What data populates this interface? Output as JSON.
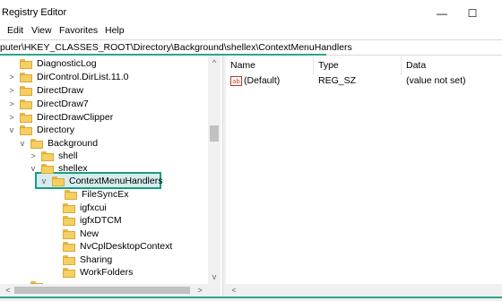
{
  "window": {
    "title": "Registry Editor",
    "minimize_glyph": "—",
    "maximize_glyph": "☐"
  },
  "menu": [
    "Edit",
    "View",
    "Favorites",
    "Help"
  ],
  "address": {
    "path": "puter\\HKEY_CLASSES_ROOT\\Directory\\Background\\shellex\\ContextMenuHandlers"
  },
  "tree": {
    "nodes": [
      {
        "label": "DiagnosticLog",
        "expander": ">"
      },
      {
        "label": "DirControl.DirList.11.0",
        "expander": ">"
      },
      {
        "label": "DirectDraw",
        "expander": ">"
      },
      {
        "label": "DirectDraw7",
        "expander": ">"
      },
      {
        "label": "DirectDrawClipper",
        "expander": ">"
      },
      {
        "label": "Directory",
        "expander": "v"
      },
      {
        "label": "Background",
        "expander": "v"
      },
      {
        "label": "shell",
        "expander": ">"
      },
      {
        "label": "shellex",
        "expander": "v"
      },
      {
        "label": "ContextMenuHandlers",
        "expander": "v"
      },
      {
        "label": "FileSyncEx",
        "expander": ""
      },
      {
        "label": "igfxcui",
        "expander": ""
      },
      {
        "label": "igfxDTCM",
        "expander": ""
      },
      {
        "label": "New",
        "expander": ""
      },
      {
        "label": "NvCplDesktopContext",
        "expander": ""
      },
      {
        "label": "Sharing",
        "expander": ""
      },
      {
        "label": "WorkFolders",
        "expander": ""
      }
    ]
  },
  "list": {
    "columns": [
      "Name",
      "Type",
      "Data"
    ],
    "rows": [
      {
        "icon": "ab",
        "name": "(Default)",
        "type": "REG_SZ",
        "data": "(value not set)"
      }
    ]
  },
  "colors": {
    "highlight": "#1a9c80",
    "accent_line": "#2aa889"
  }
}
